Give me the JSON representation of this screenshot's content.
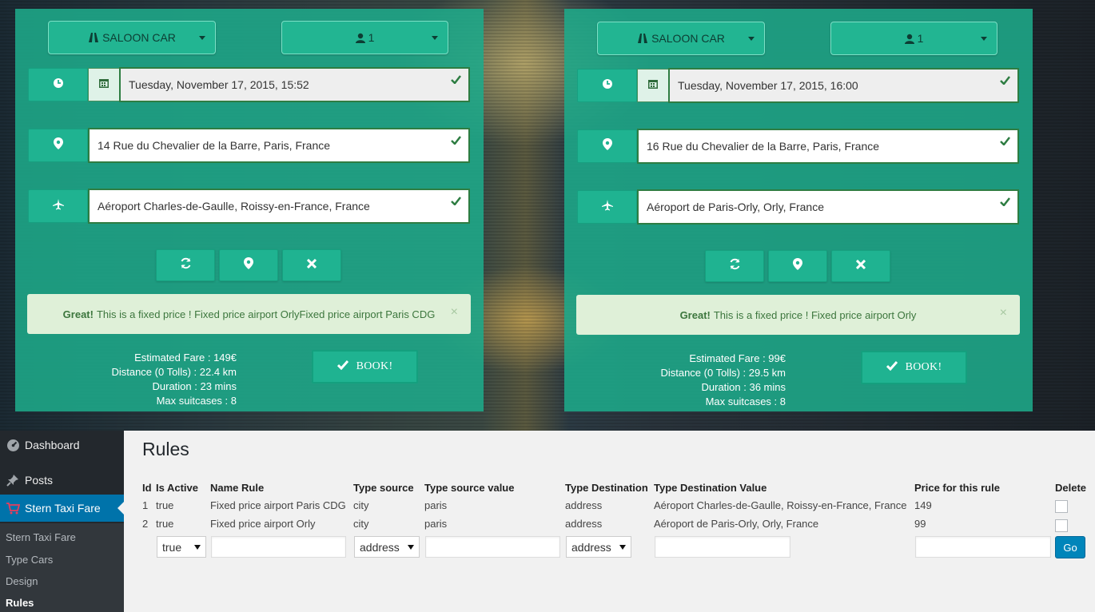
{
  "panels": [
    {
      "vehicle": "SALOON CAR",
      "passengers": "1",
      "datetime": "Tuesday, November 17, 2015, 15:52",
      "origin": "14 Rue du Chevalier de la Barre, Paris, France",
      "destination": "Aéroport Charles-de-Gaulle, Roissy-en-France, France",
      "alert_strong": "Great!",
      "alert_text": "This is a fixed price ! Fixed price airport OrlyFixed price airport Paris CDG",
      "fare": "Estimated Fare : 149€",
      "distance": "Distance (0 Tolls) : 22.4 km",
      "duration": "Duration : 23 mins",
      "suitcases": "Max suitcases : 8",
      "book_label": "BOOK!"
    },
    {
      "vehicle": "SALOON CAR",
      "passengers": "1",
      "datetime": "Tuesday, November 17, 2015, 16:00",
      "origin": "16 Rue du Chevalier de la Barre, Paris, France",
      "destination": "Aéroport de Paris-Orly, Orly, France",
      "alert_strong": "Great!",
      "alert_text": "This is a fixed price ! Fixed price airport Orly",
      "fare": "Estimated Fare : 99€",
      "distance": "Distance (0 Tolls) : 29.5 km",
      "duration": "Duration : 36 mins",
      "suitcases": "Max suitcases : 8",
      "book_label": "BOOK!"
    }
  ],
  "sidebar": {
    "items": [
      {
        "label": "Dashboard",
        "icon": "dashboard-icon"
      },
      {
        "label": "Posts",
        "icon": "pin-icon"
      },
      {
        "label": "Stern Taxi Fare",
        "icon": "cart-icon"
      }
    ],
    "submenu": [
      "Stern Taxi Fare",
      "Type Cars",
      "Design",
      "Rules"
    ]
  },
  "rules": {
    "title": "Rules",
    "headers": [
      "Id",
      "Is Active",
      "Name Rule",
      "Type source",
      "Type source value",
      "Type Destination",
      "Type Destination Value",
      "Price for this rule",
      "Delete"
    ],
    "rows": [
      {
        "id": "1",
        "active": "true",
        "name": "Fixed price airport Paris CDG",
        "type_source": "city",
        "source_value": "paris",
        "type_dest": "address",
        "dest_value": "Aéroport Charles-de-Gaulle, Roissy-en-France, France",
        "price": "149"
      },
      {
        "id": "2",
        "active": "true",
        "name": "Fixed price airport Orly",
        "type_source": "city",
        "source_value": "paris",
        "type_dest": "address",
        "dest_value": "Aéroport de Paris-Orly, Orly, France",
        "price": "99"
      }
    ],
    "form": {
      "active": "true",
      "type_source": "address",
      "type_dest": "address",
      "go": "Go"
    }
  },
  "colors": {
    "panel": "#1eaa8a",
    "admin_accent": "#0073aa",
    "go_button": "#0085ba"
  }
}
